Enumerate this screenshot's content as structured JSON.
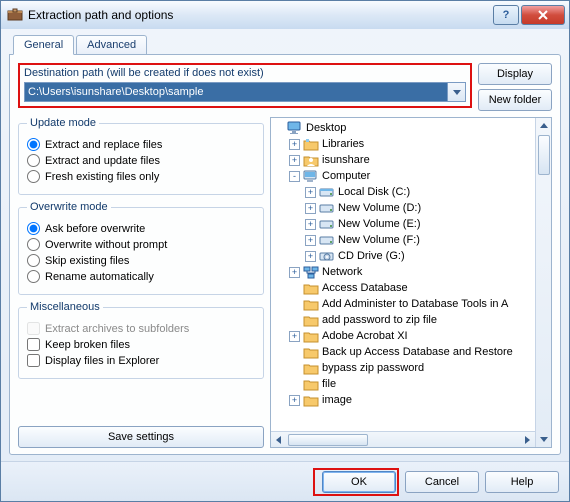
{
  "window": {
    "title": "Extraction path and options"
  },
  "tabs": {
    "general": "General",
    "advanced": "Advanced"
  },
  "dest": {
    "label": "Destination path (will be created if does not exist)",
    "value": "C:\\Users\\isunshare\\Desktop\\sample"
  },
  "buttons": {
    "display": "Display",
    "new_folder": "New folder",
    "save_settings": "Save settings",
    "ok": "OK",
    "cancel": "Cancel",
    "help": "Help"
  },
  "groups": {
    "update_mode": {
      "legend": "Update mode",
      "opt1": "Extract and replace files",
      "opt2": "Extract and update files",
      "opt3": "Fresh existing files only"
    },
    "overwrite_mode": {
      "legend": "Overwrite mode",
      "opt1": "Ask before overwrite",
      "opt2": "Overwrite without prompt",
      "opt3": "Skip existing files",
      "opt4": "Rename automatically"
    },
    "misc": {
      "legend": "Miscellaneous",
      "opt1": "Extract archives to subfolders",
      "opt2": "Keep broken files",
      "opt3": "Display files in Explorer"
    }
  },
  "tree": {
    "nodes": [
      {
        "indent": 0,
        "exp": "",
        "icon": "desktop",
        "label": "Desktop"
      },
      {
        "indent": 1,
        "exp": "+",
        "icon": "libraries",
        "label": "Libraries"
      },
      {
        "indent": 1,
        "exp": "+",
        "icon": "user",
        "label": "isunshare"
      },
      {
        "indent": 1,
        "exp": "-",
        "icon": "computer",
        "label": "Computer"
      },
      {
        "indent": 2,
        "exp": "+",
        "icon": "drive-c",
        "label": "Local Disk (C:)"
      },
      {
        "indent": 2,
        "exp": "+",
        "icon": "drive",
        "label": "New Volume (D:)"
      },
      {
        "indent": 2,
        "exp": "+",
        "icon": "drive",
        "label": "New Volume (E:)"
      },
      {
        "indent": 2,
        "exp": "+",
        "icon": "drive",
        "label": "New Volume (F:)"
      },
      {
        "indent": 2,
        "exp": "+",
        "icon": "cd",
        "label": "CD Drive (G:)"
      },
      {
        "indent": 1,
        "exp": "+",
        "icon": "network",
        "label": "Network"
      },
      {
        "indent": 1,
        "exp": "",
        "icon": "folder",
        "label": "Access Database"
      },
      {
        "indent": 1,
        "exp": "",
        "icon": "folder",
        "label": "Add Administer to Database Tools in A"
      },
      {
        "indent": 1,
        "exp": "",
        "icon": "folder",
        "label": "add password  to zip file"
      },
      {
        "indent": 1,
        "exp": "+",
        "icon": "folder",
        "label": "Adobe Acrobat XI"
      },
      {
        "indent": 1,
        "exp": "",
        "icon": "folder",
        "label": "Back up Access Database and Restore"
      },
      {
        "indent": 1,
        "exp": "",
        "icon": "folder",
        "label": "bypass zip password"
      },
      {
        "indent": 1,
        "exp": "",
        "icon": "folder",
        "label": "file"
      },
      {
        "indent": 1,
        "exp": "+",
        "icon": "folder",
        "label": "image"
      }
    ]
  }
}
